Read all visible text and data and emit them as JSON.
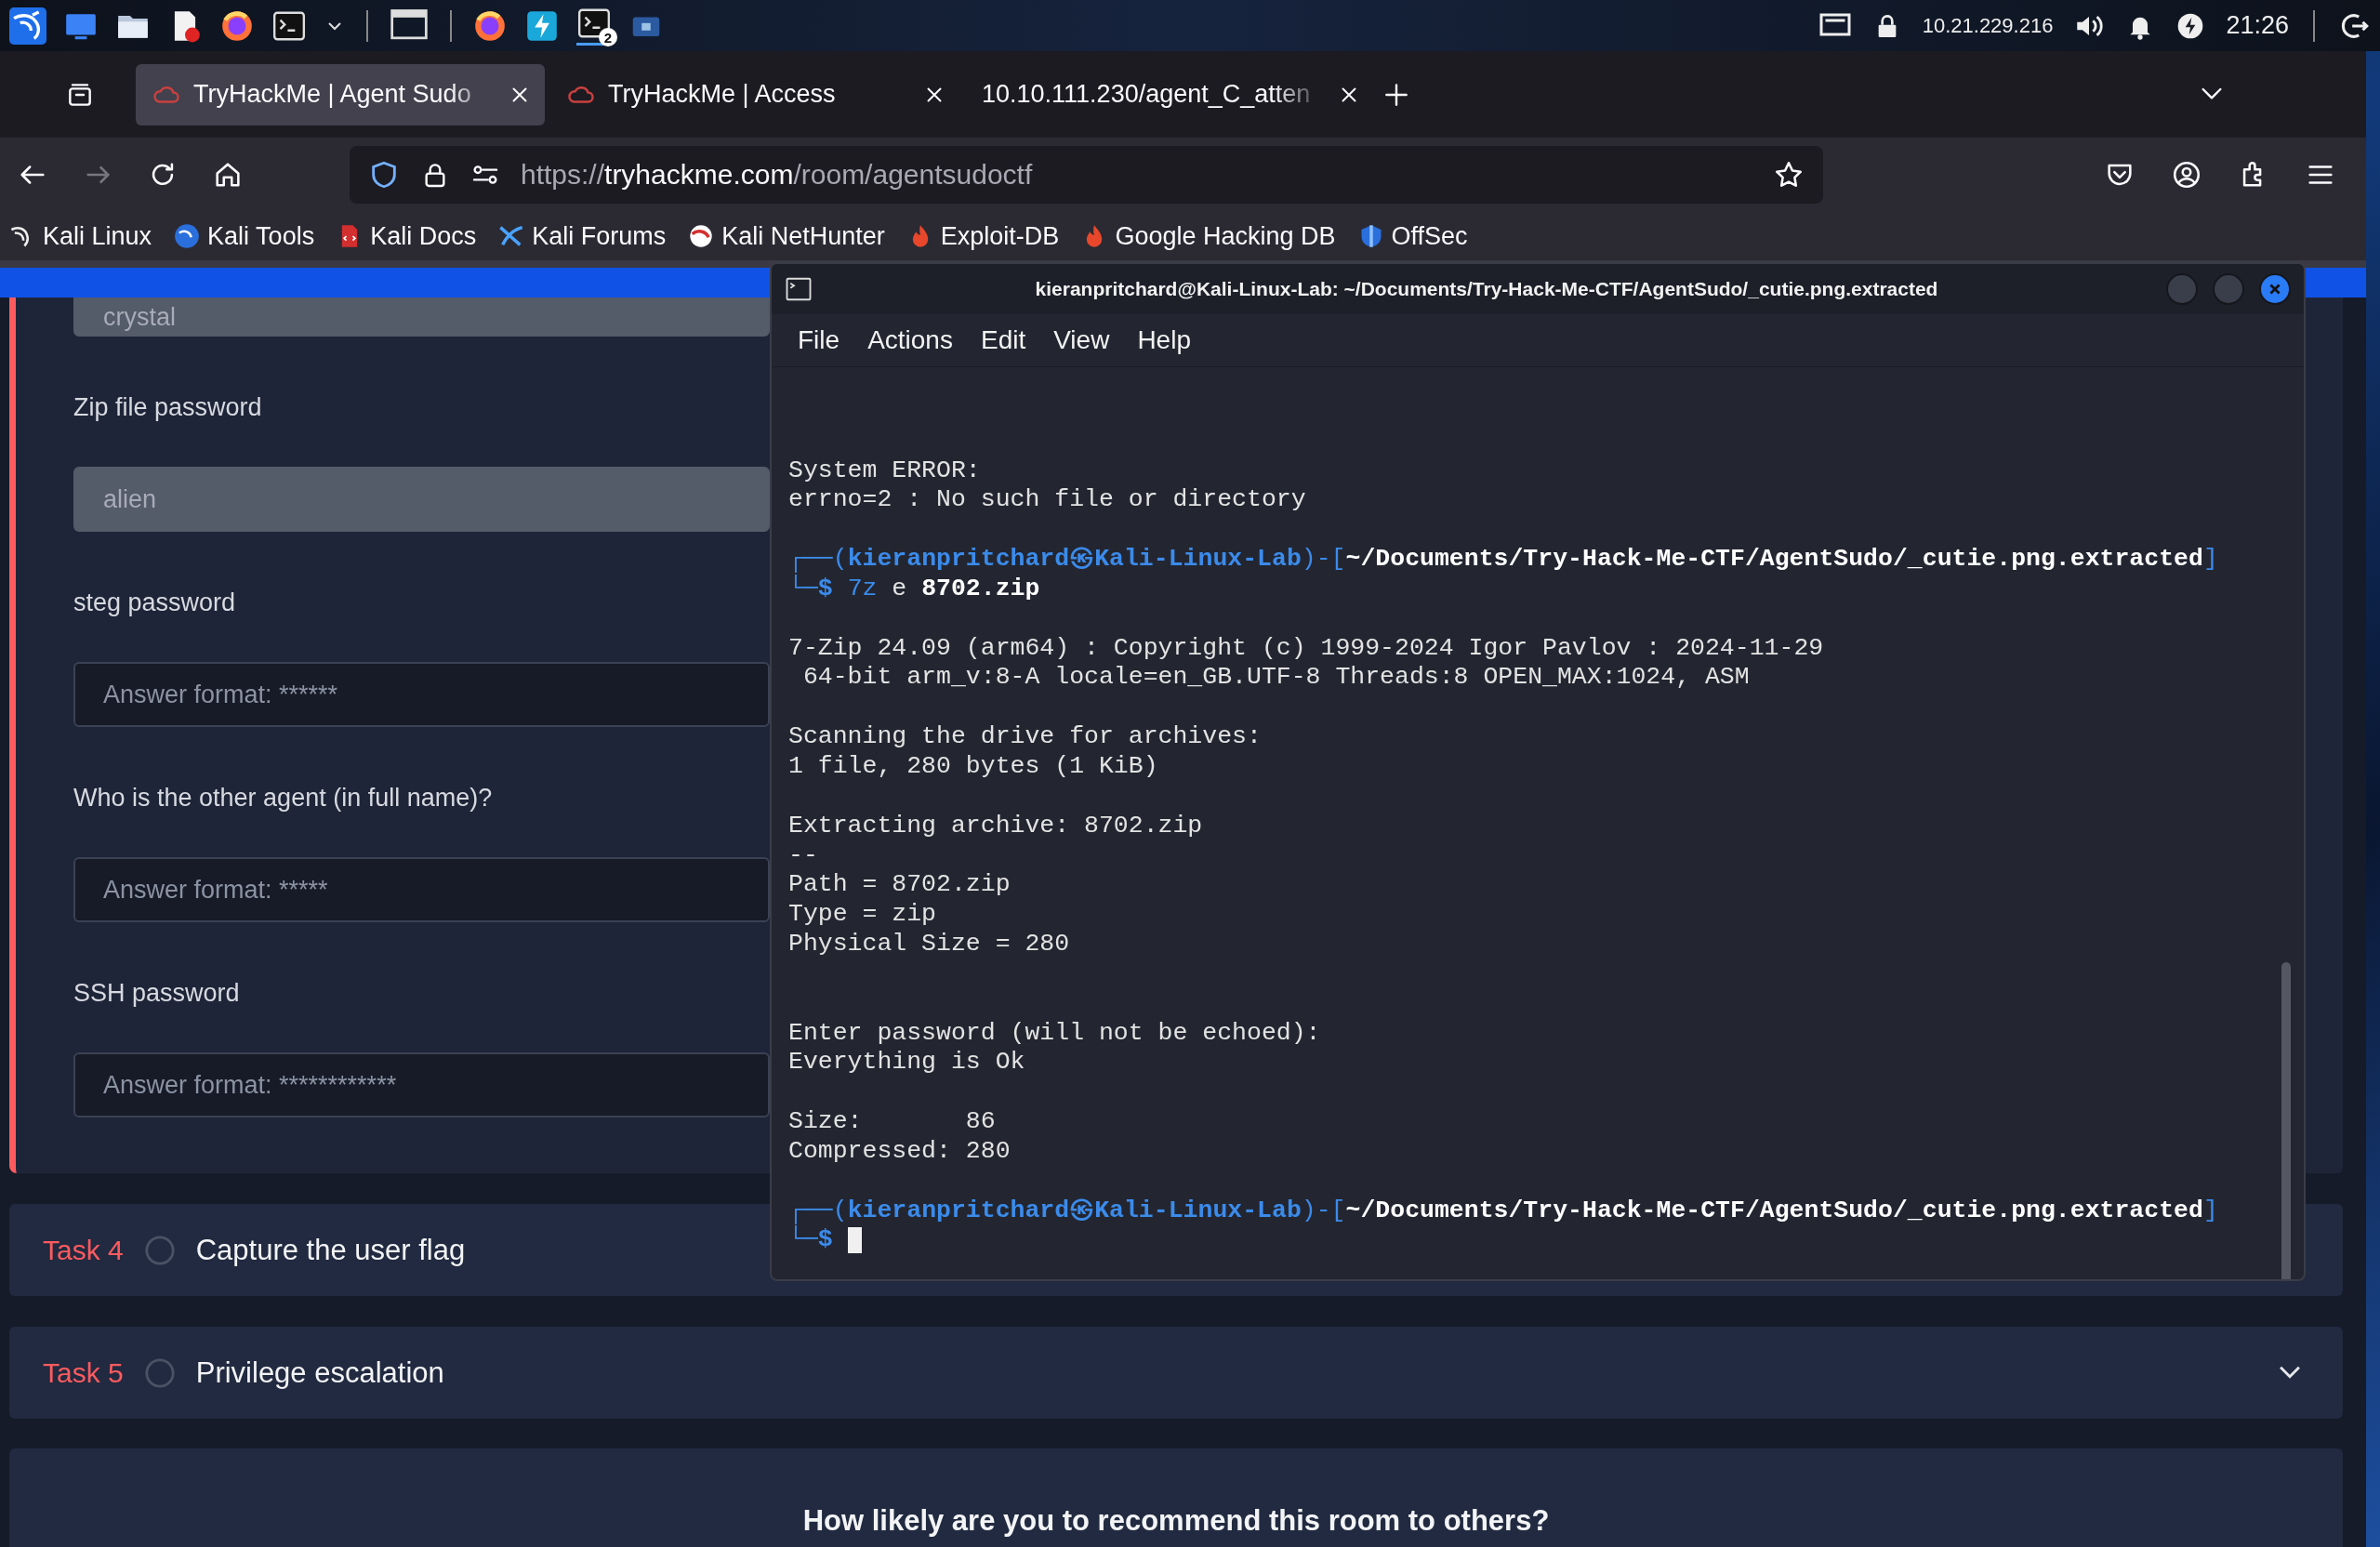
{
  "taskbar": {
    "terminal_badge": "2",
    "ip_address": "10.21.229.216",
    "clock": "21:26"
  },
  "browser": {
    "tabs": [
      {
        "title": "TryHackMe | Agent Sudo",
        "selected": true,
        "kind": "site"
      },
      {
        "title": "TryHackMe | Access",
        "selected": false,
        "kind": "site"
      },
      {
        "title": "10.10.111.230/agent_C_atten",
        "selected": false,
        "kind": "plain"
      }
    ],
    "url": {
      "scheme": "https://",
      "host": "tryhackme.com",
      "path": "/room/agentsudoctf"
    },
    "bookmarks": [
      "Kali Linux",
      "Kali Tools",
      "Kali Docs",
      "Kali Forums",
      "Kali NetHunter",
      "Exploit-DB",
      "Google Hacking DB",
      "OffSec"
    ]
  },
  "page": {
    "answers": [
      {
        "value": "crystal",
        "disabled": true
      },
      {
        "label": "Zip file password",
        "value": "alien",
        "disabled": true
      },
      {
        "label": "steg password",
        "placeholder": "Answer format: ******",
        "disabled": false
      },
      {
        "label": "Who is the other agent (in full name)?",
        "placeholder": "Answer format: *****",
        "disabled": false
      },
      {
        "label": "SSH password",
        "placeholder": "Answer format: ************",
        "disabled": false
      }
    ],
    "tasks": [
      {
        "number": "Task 4",
        "title": "Capture the user flag",
        "completed": false
      },
      {
        "number": "Task 5",
        "title": "Privilege escalation",
        "completed": false
      }
    ],
    "feedback": {
      "question": "How likely are you to recommend this room to others?"
    }
  },
  "terminal": {
    "title": "kieranpritchard@Kali-Linux-Lab: ~/Documents/Try-Hack-Me-CTF/AgentSudo/_cutie.png.extracted",
    "menu": [
      "File",
      "Actions",
      "Edit",
      "View",
      "Help"
    ],
    "lines": [
      {
        "kind": "blank"
      },
      {
        "kind": "blank"
      },
      {
        "kind": "blank"
      },
      {
        "kind": "text",
        "text": "System ERROR:"
      },
      {
        "kind": "text",
        "text": "errno=2 : No such file or directory"
      },
      {
        "kind": "blank"
      },
      {
        "kind": "segments",
        "segments": [
          {
            "kind": "frame",
            "text": "┌──("
          },
          {
            "kind": "host",
            "text": "kieranpritchard㉿Kali-Linux-Lab"
          },
          {
            "kind": "frame",
            "text": ")-["
          },
          {
            "kind": "path",
            "text": "~/Documents/Try-Hack-Me-CTF/AgentSudo/_cutie.png.extracted"
          },
          {
            "kind": "frame",
            "text": "]"
          }
        ]
      },
      {
        "kind": "segments",
        "segments": [
          {
            "kind": "frame",
            "text": "└─"
          },
          {
            "kind": "host",
            "text": "$ "
          },
          {
            "kind": "command",
            "text": "7z"
          },
          {
            "kind": "plain",
            "text": " e "
          },
          {
            "kind": "bold",
            "text": "8702.zip"
          }
        ]
      },
      {
        "kind": "blank"
      },
      {
        "kind": "text",
        "text": "7-Zip 24.09 (arm64) : Copyright (c) 1999-2024 Igor Pavlov : 2024-11-29"
      },
      {
        "kind": "text",
        "text": " 64-bit arm_v:8-A locale=en_GB.UTF-8 Threads:8 OPEN_MAX:1024, ASM"
      },
      {
        "kind": "blank"
      },
      {
        "kind": "text",
        "text": "Scanning the drive for archives:"
      },
      {
        "kind": "text",
        "text": "1 file, 280 bytes (1 KiB)"
      },
      {
        "kind": "blank"
      },
      {
        "kind": "text",
        "text": "Extracting archive: 8702.zip"
      },
      {
        "kind": "text",
        "text": "--"
      },
      {
        "kind": "text",
        "text": "Path = 8702.zip"
      },
      {
        "kind": "text",
        "text": "Type = zip"
      },
      {
        "kind": "text",
        "text": "Physical Size = 280"
      },
      {
        "kind": "blank"
      },
      {
        "kind": "blank"
      },
      {
        "kind": "text",
        "text": "Enter password (will not be echoed):"
      },
      {
        "kind": "text",
        "text": "Everything is Ok"
      },
      {
        "kind": "blank"
      },
      {
        "kind": "text",
        "text": "Size:       86"
      },
      {
        "kind": "text",
        "text": "Compressed: 280"
      },
      {
        "kind": "blank"
      },
      {
        "kind": "segments",
        "segments": [
          {
            "kind": "frame",
            "text": "┌──("
          },
          {
            "kind": "host",
            "text": "kieranpritchard㉿Kali-Linux-Lab"
          },
          {
            "kind": "frame",
            "text": ")-["
          },
          {
            "kind": "path",
            "text": "~/Documents/Try-Hack-Me-CTF/AgentSudo/_cutie.png.extracted"
          },
          {
            "kind": "frame",
            "text": "]"
          }
        ]
      },
      {
        "kind": "segments",
        "cursor": true,
        "segments": [
          {
            "kind": "frame",
            "text": "└─"
          },
          {
            "kind": "host",
            "text": "$ "
          }
        ]
      }
    ]
  }
}
